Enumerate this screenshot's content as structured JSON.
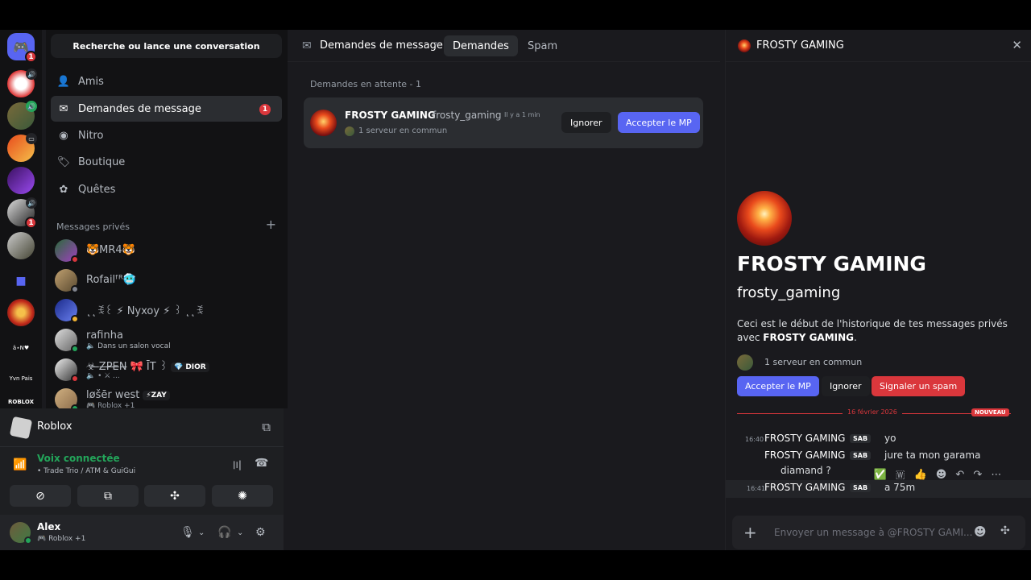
{
  "rail": {
    "home_badge": "1",
    "server_badge": "1",
    "text_server_1": "ä⋆N♥",
    "text_server_2": "Yvn Pais",
    "text_server_3": "ROBLOX"
  },
  "sidebar": {
    "search_label": "Recherche ou lance une conversation",
    "nav": [
      {
        "label": "Amis",
        "icon": "friends-icon"
      },
      {
        "label": "Demandes de message",
        "icon": "envelope-icon",
        "badge": "1"
      },
      {
        "label": "Nitro",
        "icon": "nitro-icon"
      },
      {
        "label": "Boutique",
        "icon": "shop-icon"
      },
      {
        "label": "Quêtes",
        "icon": "quests-icon"
      }
    ],
    "private_messages_header": "Messages privés",
    "dms": [
      {
        "name": "🐯MR4🐯"
      },
      {
        "name": "Rofailᶠᴿ🥶"
      },
      {
        "name": "˛˛ꉂ꒰ ⚡ Nyxoy ⚡ ꒱ ˛˛ꉂ"
      },
      {
        "name": "rafinha",
        "sub": "🔈 Dans un salon vocal"
      },
      {
        "name": "☣︎ ̶Z̶P̶E̶N̶ 🎀 ĪT ꒱",
        "tag": "💎 DIOR",
        "sub": "🔈 • ⚔ ..."
      },
      {
        "name": "løšēr west",
        "tag": "⚡ZAY",
        "sub": "🎮 Roblox +1"
      }
    ]
  },
  "voice": {
    "activity": "Roblox",
    "status": "Voix connectée",
    "channel": "• Trade Trio / ATM & GuiGui",
    "user_name": "Alex",
    "user_status": "🎮 Roblox +1"
  },
  "middle": {
    "title": "Demandes de message",
    "tab_requests": "Demandes",
    "tab_spam": "Spam",
    "pending_label": "Demandes en attente - 1",
    "request": {
      "display_name": "FROSTY GAMING",
      "username": "frosty_gaming",
      "time": "Il y a 1 min",
      "mutual": "1 serveur en commun",
      "ignore_label": "Ignorer",
      "accept_label": "Accepter le MP"
    }
  },
  "panel": {
    "header_title": "FROSTY GAMING",
    "display_name": "FROSTY GAMING",
    "username": "frosty_gaming",
    "desc_prefix": "Ceci est le début de l'historique de tes messages privés avec ",
    "desc_name": "FROSTY GAMING",
    "desc_suffix": ".",
    "mutual": "1 serveur en commun",
    "accept_label": "Accepter le MP",
    "ignore_label": "Ignorer",
    "spam_label": "Signaler un spam",
    "date_divider": "16 février 2026",
    "new_badge": "NOUVEAU",
    "messages": [
      {
        "time": "16:40",
        "author": "FROSTY GAMING",
        "tag": "SAB",
        "text": "yo"
      },
      {
        "time": "",
        "author": "FROSTY GAMING",
        "tag": "SAB",
        "text": "jure ta mon garama",
        "text2": "diamand ?"
      },
      {
        "time": "16:41",
        "author": "FROSTY GAMING",
        "tag": "SAB",
        "text": "a 75m"
      }
    ],
    "composer_placeholder": "Envoyer un message à @FROSTY GAMI..."
  },
  "colors": {
    "blurple": "#5865f2",
    "danger": "#da373c",
    "online": "#23a55a"
  }
}
